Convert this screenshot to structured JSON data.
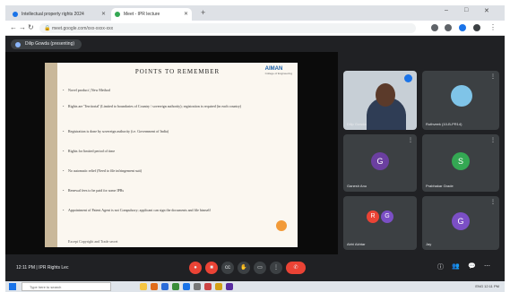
{
  "browser": {
    "tabs": [
      {
        "title": "Intellectual property rights 2024"
      },
      {
        "title": "Meet - IPR lecture"
      }
    ],
    "new_tab": "+",
    "url": "meet.google.com/xxx-xxxx-xxx",
    "window_controls": [
      "–",
      "□",
      "✕"
    ]
  },
  "meet": {
    "presenter_label": "Dilip Gowda (presenting)",
    "time_label": "12:11 PM | IPR Rights Lec",
    "tiles": [
      {
        "name": "Dilip Gowda",
        "type": "video"
      },
      {
        "name": "Ruthveek (10-B-PR14)",
        "type": "image"
      },
      {
        "name": "Ganesh Anu",
        "initial": "G",
        "color": "#6b3fa0"
      },
      {
        "name": "Prabhakar Grade",
        "initial": "S",
        "color": "#34a853"
      },
      {
        "name": "Abhi Akhtar",
        "initials": [
          "R",
          "G"
        ],
        "colors": [
          "#ea4335",
          "#7b4fc5"
        ]
      },
      {
        "name": "Jay",
        "initial": "G",
        "color": "#7b4fc5"
      }
    ],
    "controls": [
      "mic-off",
      "cam-off",
      "cc",
      "hand",
      "present",
      "more",
      "end"
    ],
    "right_controls": [
      "ⓘ",
      "👥",
      "💬",
      "⋯"
    ]
  },
  "slide": {
    "title": "POINTS TO REMEMBER",
    "logo": "AIMAN",
    "logo_sub": "College of Engineering",
    "bullets": [
      "Novel product | New Method",
      "Rights are 'Territorial' (Limited to boundaries of Country / sovereign authority); registration is required (in each country)",
      "Registration is done by sovereign authority (i.e. Government of India)",
      "Rights for limited period of time",
      "No automatic relief (Need to file infringement suit)",
      "Renewal fees to be paid for some IPRs",
      "Appointment of Patent Agent is not Compulsory; applicant can sign the documents and file himself"
    ],
    "footer": "Except Copyright and Trade secret"
  },
  "taskbar": {
    "search_placeholder": "Type here to search",
    "tray": "ENG 12:11 PM"
  },
  "colors": {
    "meet_bg": "#202124",
    "tile_bg": "#3c4043",
    "end_call": "#ea4335",
    "accent": "#1a73e8"
  }
}
